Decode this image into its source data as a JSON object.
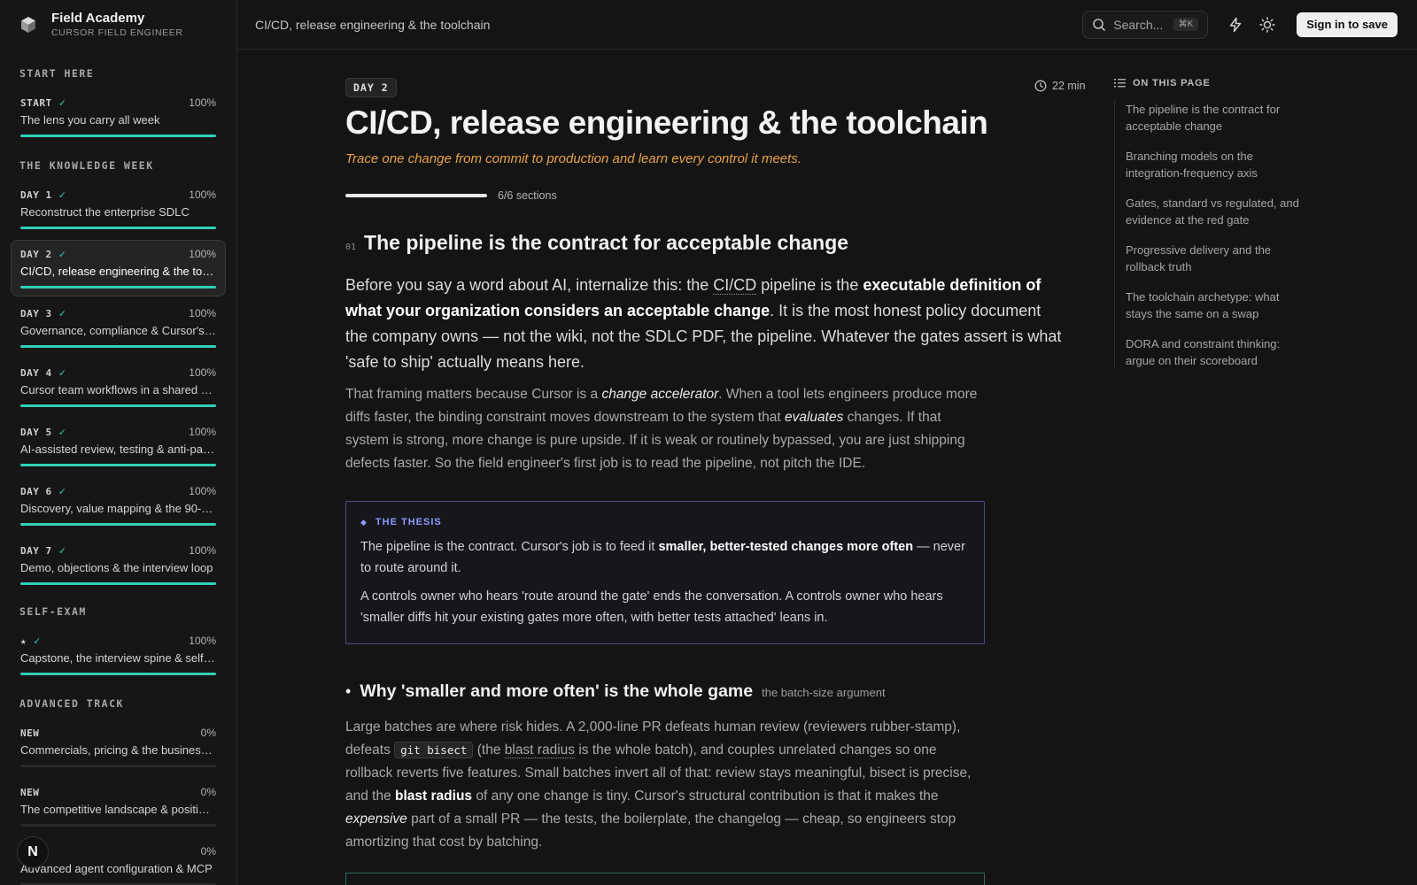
{
  "brand": {
    "name": "Field Academy",
    "subtitle": "CURSOR FIELD ENGINEER"
  },
  "sidebar": {
    "sections": {
      "start_here": "START HERE",
      "knowledge_week": "THE KNOWLEDGE WEEK",
      "self_exam": "SELF-EXAM",
      "advanced": "ADVANCED TRACK"
    },
    "items": [
      {
        "tag": "START",
        "pct": "100%",
        "progress": 1.0,
        "done": true,
        "title": "The lens you carry all week"
      },
      {
        "tag": "DAY 1",
        "pct": "100%",
        "progress": 1.0,
        "done": true,
        "title": "Reconstruct the enterprise SDLC"
      },
      {
        "tag": "DAY 2",
        "pct": "100%",
        "progress": 1.0,
        "done": true,
        "active": true,
        "title": "CI/CD, release engineering & the toolchain"
      },
      {
        "tag": "DAY 3",
        "pct": "100%",
        "progress": 1.0,
        "done": true,
        "title": "Governance, compliance & Cursor's controls"
      },
      {
        "tag": "DAY 4",
        "pct": "100%",
        "progress": 1.0,
        "done": true,
        "title": "Cursor team workflows in a shared codebase"
      },
      {
        "tag": "DAY 5",
        "pct": "100%",
        "progress": 1.0,
        "done": true,
        "title": "AI-assisted review, testing & anti-patterns"
      },
      {
        "tag": "DAY 6",
        "pct": "100%",
        "progress": 1.0,
        "done": true,
        "title": "Discovery, value mapping & the 90-day plan"
      },
      {
        "tag": "DAY 7",
        "pct": "100%",
        "progress": 1.0,
        "done": true,
        "title": "Demo, objections & the interview loop"
      },
      {
        "tag": "★",
        "pct": "100%",
        "progress": 1.0,
        "done": true,
        "title": "Capstone, the interview spine & self-check"
      },
      {
        "tag": "NEW",
        "pct": "0%",
        "progress": 0,
        "done": false,
        "title": "Commercials, pricing & the business case"
      },
      {
        "tag": "NEW",
        "pct": "0%",
        "progress": 0,
        "done": false,
        "title": "The competitive landscape & positioning"
      },
      {
        "tag": "NEW",
        "pct": "0%",
        "progress": 0,
        "done": false,
        "title": "Advanced agent configuration & MCP"
      }
    ],
    "avatar_letter": "N"
  },
  "topbar": {
    "breadcrumb": "CI/CD, release engineering & the toolchain",
    "search_placeholder": "Search...",
    "search_shortcut": "⌘K",
    "signin_label": "Sign in to save"
  },
  "article": {
    "day_badge": "DAY 2",
    "read_time": "22 min",
    "title": "CI/CD, release engineering & the toolchain",
    "tagline": "Trace one change from commit to production and learn every control it meets.",
    "progress_fraction": 1.0,
    "progress_label": "6/6 sections",
    "section_num": "01",
    "section_title": "The pipeline is the contract for acceptable change",
    "lead": {
      "p1": "Before you say a word about AI, internalize this: the ",
      "term": "CI/CD",
      "p2": " pipeline is the ",
      "bold": "executable definition of what your organization considers an acceptable change",
      "p3": ". It is the most honest policy document the company owns — not the wiki, not the SDLC PDF, the pipeline. Whatever the gates assert is what 'safe to ship' actually means here."
    },
    "para1": {
      "p1": "That framing matters because Cursor is a ",
      "em1": "change accelerator",
      "p2": ". When a tool lets engineers produce more diffs faster, the binding constraint moves downstream to the system that ",
      "em2": "evaluates",
      "p3": " changes. If that system is strong, more change is pure upside. If it is weak or routinely bypassed, you are just shipping defects faster. So the field engineer's first job is to read the pipeline, not pitch the IDE."
    },
    "callout": {
      "label": "THE THESIS",
      "p1a": "The pipeline is the contract. Cursor's job is to feed it ",
      "p1b": "smaller, better-tested changes more often",
      "p1c": " — never to route around it.",
      "p2": "A controls owner who hears 'route around the gate' ends the conversation. A controls owner who hears 'smaller diffs hit your existing gates more often, with better tests attached' leans in."
    },
    "subsection_title": "Why 'smaller and more often' is the whole game",
    "subsection_sub": "the batch-size argument",
    "para2": {
      "p1": "Large batches are where risk hides. A 2,000-line PR defeats human review (reviewers rubber-stamp), defeats ",
      "code": "git bisect",
      "p2": " (the ",
      "term": "blast radius",
      "p3": " is the whole batch), and couples unrelated changes so one rollback reverts five features. Small batches invert all of that: review stays meaningful, bisect is precise, and the ",
      "bold": "blast radius",
      "p4": " of any one change is tiny. Cursor's structural contribution is that it makes the ",
      "em": "expensive",
      "p5": " part of a small PR — the tests, the boilerplate, the changelog — cheap, so engineers stop amortizing that cost by batching."
    }
  },
  "toc": {
    "heading": "ON THIS PAGE",
    "items": [
      "The pipeline is the contract for acceptable change",
      "Branching models on the integration-frequency axis",
      "Gates, standard vs regulated, and evidence at the red gate",
      "Progressive delivery and the rollback truth",
      "The toolchain archetype: what stays the same on a swap",
      "DORA and constraint thinking: argue on their scoreboard"
    ]
  },
  "colors": {
    "accent": "#2fd0b8",
    "tagline": "#e8a14a",
    "callout_border": "#4a4f86",
    "callout_label": "#8f9bff"
  }
}
